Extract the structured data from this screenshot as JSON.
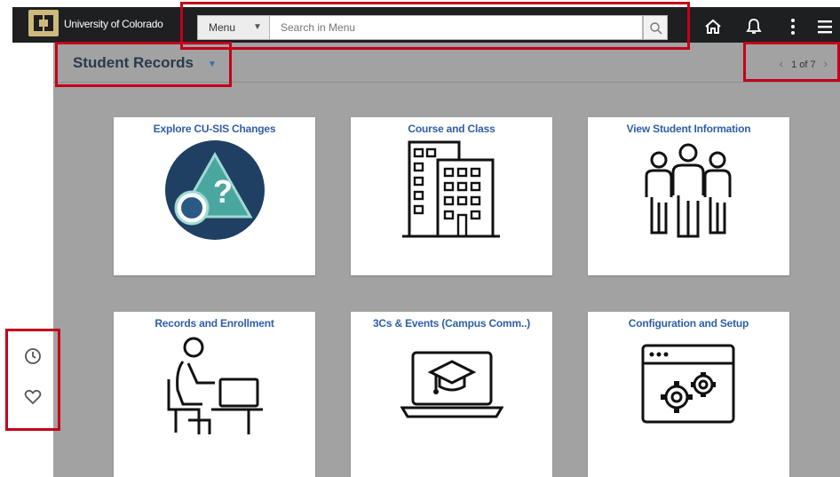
{
  "header": {
    "university_name": "University of Colorado",
    "menu_label": "Menu",
    "search_placeholder": "Search in Menu"
  },
  "page": {
    "title": "Student Records",
    "pager": "1 of 7"
  },
  "tiles": [
    {
      "label": "Explore CU-SIS Changes"
    },
    {
      "label": "Course and Class"
    },
    {
      "label": "View Student Information"
    },
    {
      "label": "Records and Enrollment"
    },
    {
      "label": "3Cs & Events (Campus Comm..)"
    },
    {
      "label": "Configuration and Setup"
    }
  ],
  "colors": {
    "topbar": "#1e1f21",
    "brand_gold": "#cfb87c",
    "content_bg": "#a2a2a2",
    "tile_title": "#2f5fa7",
    "highlight": "#c40019"
  },
  "icons": {
    "header": [
      "cu-logo-icon",
      "search-icon",
      "home-icon",
      "bell-icon",
      "kebab-menu-icon",
      "hamburger-icon"
    ],
    "sidebar": [
      "recent-clock-icon",
      "favorites-heart-icon"
    ]
  }
}
